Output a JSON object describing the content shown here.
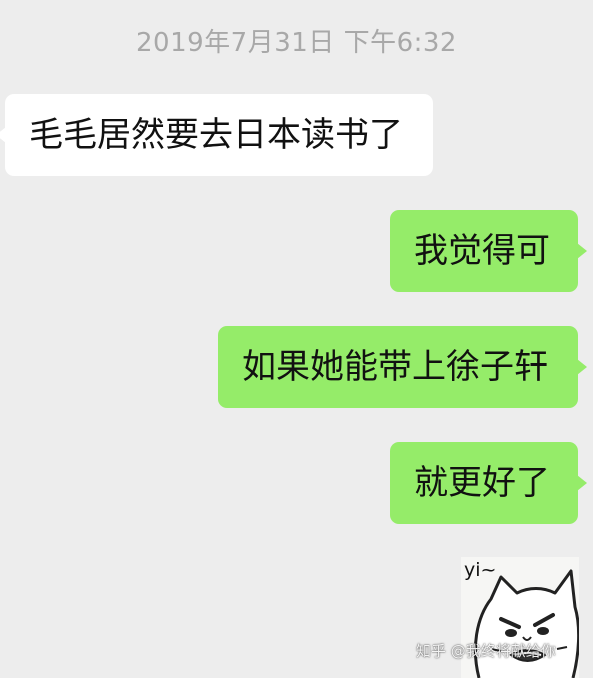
{
  "chat": {
    "timestamp": "2019年7月31日 下午6:32",
    "messages": [
      {
        "side": "incoming",
        "text": "毛毛居然要去日本读书了"
      },
      {
        "side": "outgoing",
        "text": "我觉得可"
      },
      {
        "side": "outgoing",
        "text": "如果她能带上徐子轩"
      },
      {
        "side": "outgoing",
        "text": "就更好了"
      }
    ],
    "sticker": {
      "caption": "yi~",
      "icon": "cat-face-sticker"
    }
  },
  "watermark": "知乎 @我终将献给你",
  "colors": {
    "background": "#ededed",
    "incoming_bubble": "#ffffff",
    "outgoing_bubble": "#95ec69",
    "timestamp_text": "#a8a8a8"
  }
}
